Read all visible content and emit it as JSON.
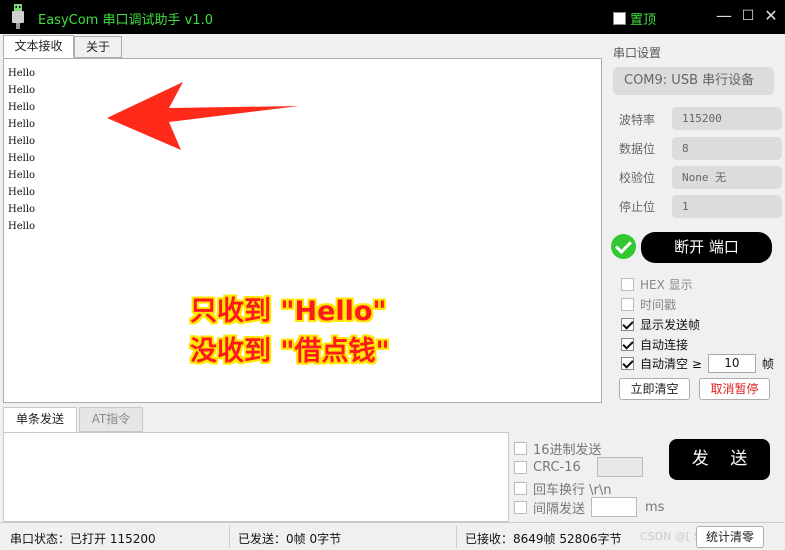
{
  "titlebar": {
    "title": "EasyCom 串口调试助手 v1.0",
    "topmost_label": "置顶",
    "minimize": "—",
    "maximize": "☐",
    "close": "✕"
  },
  "receive_tabs": [
    "文本接收",
    "关于"
  ],
  "received_lines": [
    "Hello",
    "Hello",
    "Hello",
    "Hello",
    "Hello",
    "Hello",
    "Hello",
    "Hello",
    "Hello",
    "Hello"
  ],
  "annotation": {
    "line1": "只收到 \"Hello\"",
    "line2": "没收到 \"借点钱\""
  },
  "serial_settings": {
    "section_title": "串口设置",
    "port": "COM9: USB 串行设备",
    "baud_label": "波特率",
    "baud_value": "115200",
    "databits_label": "数据位",
    "databits_value": "8",
    "parity_label": "校验位",
    "parity_value": "None  无",
    "stopbits_label": "停止位",
    "stopbits_value": "1",
    "close_port_label": "断开 端口"
  },
  "receive_options": {
    "hex_label": "HEX 显示",
    "timestamp_label": "时间戳",
    "show_sent_label": "显示发送帧",
    "auto_connect_label": "自动连接",
    "auto_clear_label": "自动清空 ≥",
    "auto_clear_value": "10",
    "auto_clear_unit": "帧",
    "clear_now_label": "立即清空",
    "cancel_pause_label": "取消暂停"
  },
  "send_tabs": [
    "单条发送",
    "AT指令"
  ],
  "send_options": {
    "hex_send_label": "16进制发送",
    "crc_label": "CRC-16",
    "crlf_label": "回车换行 \\r\\n",
    "interval_label": "间隔发送",
    "interval_unit": "ms",
    "send_label": "发 送"
  },
  "status_bar": {
    "port_status": "串口状态：已打开  115200",
    "sent": "已发送：0帧   0字节",
    "received": "已接收：8649帧   52806字节",
    "watermark": "CSDN @[  ST]",
    "clear_stats_label": "统计清零"
  },
  "colors": {
    "title_text": "#3fe03f",
    "annotation_text": "#ff1a1a",
    "annotation_outline": "#ffe600",
    "connected_icon": "#32c832"
  }
}
